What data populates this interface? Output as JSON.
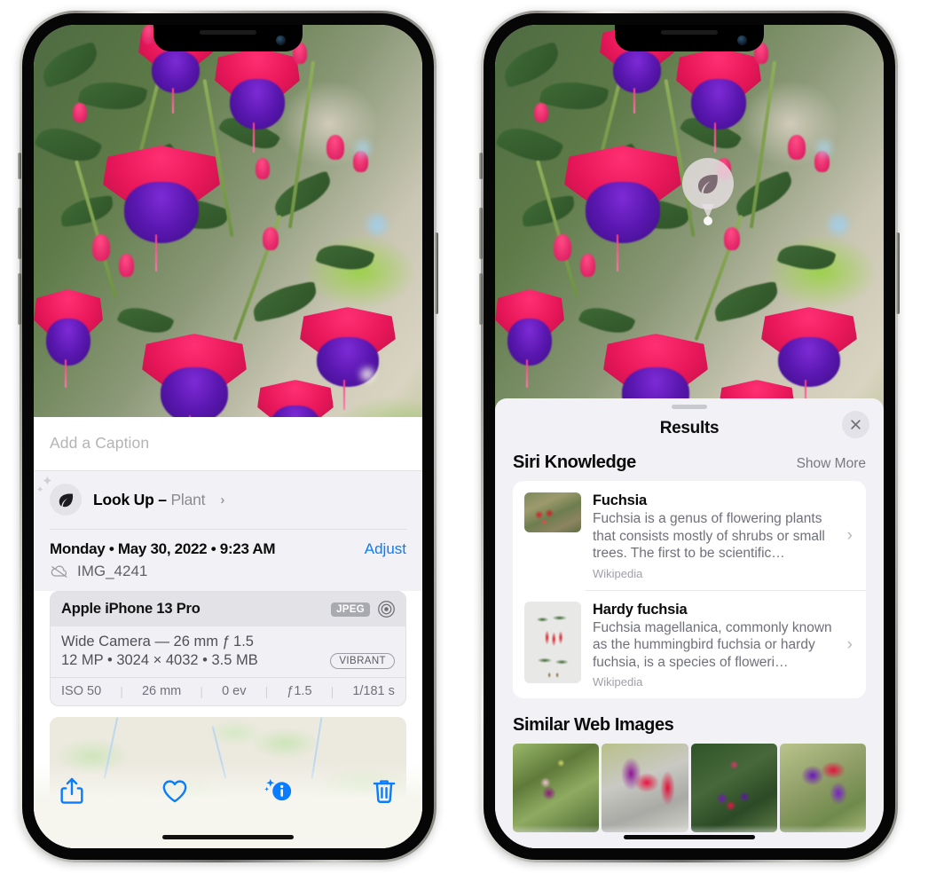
{
  "left_phone": {
    "caption": {
      "placeholder": "Add a Caption",
      "value": ""
    },
    "lookup": {
      "icon": "leaf-icon",
      "label": "Look Up – ",
      "subject": "Plant",
      "chevron": "›"
    },
    "date_row": {
      "date": "Monday • May 30, 2022 • 9:23 AM",
      "adjust_label": "Adjust"
    },
    "file_row": {
      "icon": "cloud-slash-icon",
      "filename": "IMG_4241"
    },
    "camera_card": {
      "model": "Apple iPhone 13 Pro",
      "format_tag": "JPEG",
      "aperture_icon": "aperture-icon",
      "lens_line": "Wide Camera — 26 mm ƒ 1.5",
      "specs_line": "12 MP • 3024 × 4032 • 3.5 MB",
      "style_tag": "VIBRANT",
      "exif": [
        "ISO 50",
        "26 mm",
        "0 ev",
        "ƒ1.5",
        "1/181 s"
      ],
      "exif_separator": "|"
    },
    "toolbar": [
      {
        "name": "share-button",
        "icon": "share-icon"
      },
      {
        "name": "favorite-button",
        "icon": "heart-icon"
      },
      {
        "name": "info-button",
        "icon": "info-sparkle-icon"
      },
      {
        "name": "delete-button",
        "icon": "trash-icon"
      }
    ]
  },
  "right_phone": {
    "visual_lookup_badge": {
      "icon": "leaf-icon"
    },
    "sheet": {
      "title": "Results",
      "close_icon": "close-icon",
      "siri_knowledge": {
        "title": "Siri Knowledge",
        "action": "Show More",
        "items": [
          {
            "title": "Fuchsia",
            "description": "Fuchsia is a genus of flowering plants that consists mostly of shrubs or small trees. The first to be scientific…",
            "source": "Wikipedia",
            "chevron": "›"
          },
          {
            "title": "Hardy fuchsia",
            "description": "Fuchsia magellanica, commonly known as the hummingbird fuchsia or hardy fuchsia, is a species of floweri…",
            "source": "Wikipedia",
            "chevron": "›"
          }
        ]
      },
      "similar_web_images": {
        "title": "Similar Web Images",
        "thumbnails": [
          "fuchsia-thumb-1",
          "fuchsia-thumb-2",
          "fuchsia-thumb-3",
          "fuchsia-thumb-4"
        ]
      }
    }
  },
  "colors": {
    "accent_blue": "#0a7cff",
    "sheet_background": "#f1f1f6",
    "card_background": "#ffffff",
    "secondary_text": "#70707a",
    "page_background": "#ffffff"
  }
}
